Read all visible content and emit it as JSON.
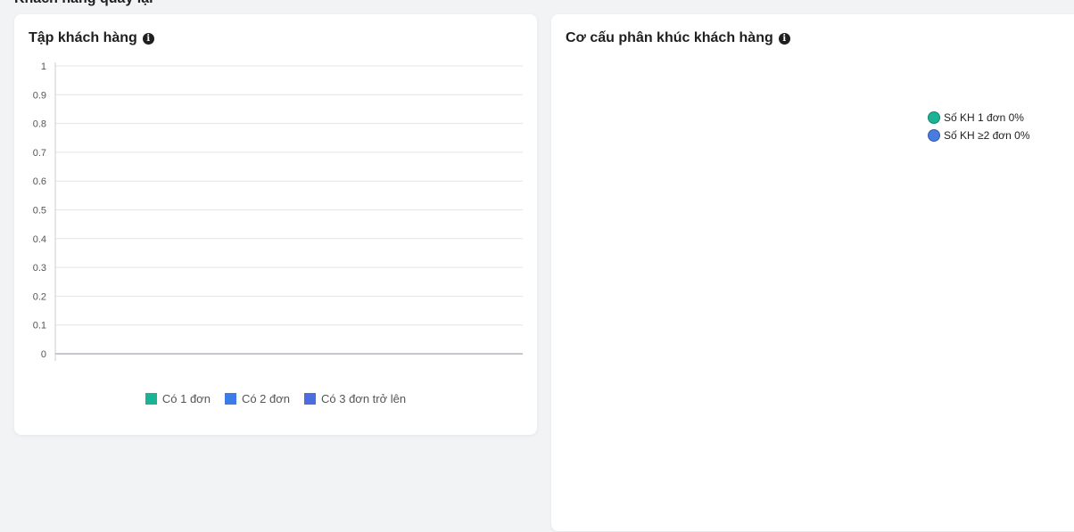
{
  "section": {
    "title": "Khách hàng quay lại"
  },
  "left_card": {
    "title": "Tập khách hàng",
    "info_icon": "info-icon",
    "legend": [
      {
        "label": "Có 1 đơn",
        "color": "#1ab394"
      },
      {
        "label": "Có 2 đơn",
        "color": "#3d7be8"
      },
      {
        "label": "Có 3 đơn trở lên",
        "color": "#4a6ee0"
      }
    ]
  },
  "right_card": {
    "title": "Cơ cấu phân khúc khách hàng",
    "info_icon": "info-icon",
    "legend": [
      {
        "label": "Số KH 1 đơn 0%",
        "color": "#1ab394"
      },
      {
        "label": "Số KH ≥2 đơn 0%",
        "color": "#4a7be0"
      }
    ]
  },
  "chart_data": {
    "type": "bar",
    "categories": [],
    "series": [
      {
        "name": "Có 1 đơn",
        "values": []
      },
      {
        "name": "Có 2 đơn",
        "values": []
      },
      {
        "name": "Có 3 đơn trở lên",
        "values": []
      }
    ],
    "yticks": [
      "0",
      "0.1",
      "0.2",
      "0.3",
      "0.4",
      "0.5",
      "0.6",
      "0.7",
      "0.8",
      "0.9",
      "1"
    ],
    "ylim": [
      0,
      1
    ],
    "grid": true,
    "legend_position": "bottom"
  }
}
